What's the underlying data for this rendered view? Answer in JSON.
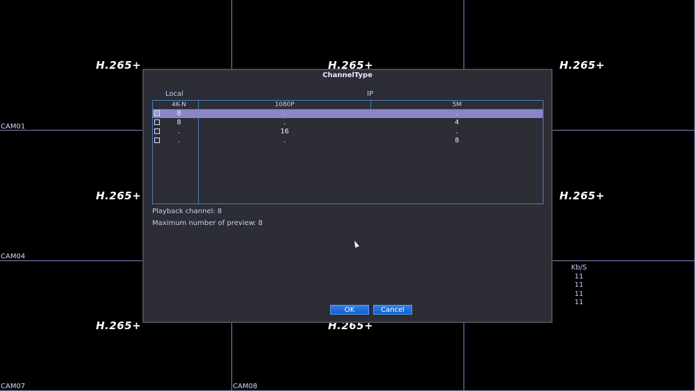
{
  "codec_label": "H.265+",
  "cameras": {
    "cam01": "CAM01",
    "cam04": "CAM04",
    "cam07": "CAM07",
    "cam08": "CAM08"
  },
  "bitrate": {
    "header": "Kb/S",
    "values": [
      "11",
      "11",
      "11",
      "11"
    ]
  },
  "dialog": {
    "title": "ChannelType",
    "group_local": "Local",
    "group_ip": "IP",
    "columns": [
      "4K-N",
      "1080P",
      "5M"
    ],
    "rows": [
      {
        "checked": true,
        "local": "8",
        "ip_1080p": ".",
        "ip_5m": "."
      },
      {
        "checked": false,
        "local": "8",
        "ip_1080p": ".",
        "ip_5m": "4"
      },
      {
        "checked": false,
        "local": ".",
        "ip_1080p": "16",
        "ip_5m": "."
      },
      {
        "checked": false,
        "local": ".",
        "ip_1080p": ".",
        "ip_5m": "8"
      }
    ],
    "playback_channel": "Playback channel: 8",
    "max_preview_label": "Maximum number of preview",
    "max_preview_value": ": 8",
    "ok_label": "OK",
    "cancel_label": "Cancel"
  },
  "colors": {
    "grid_line": "#8d86c9",
    "dialog_bg": "#2c2d35",
    "selected_row": "#8a86c8",
    "button": "#1a66d8"
  }
}
